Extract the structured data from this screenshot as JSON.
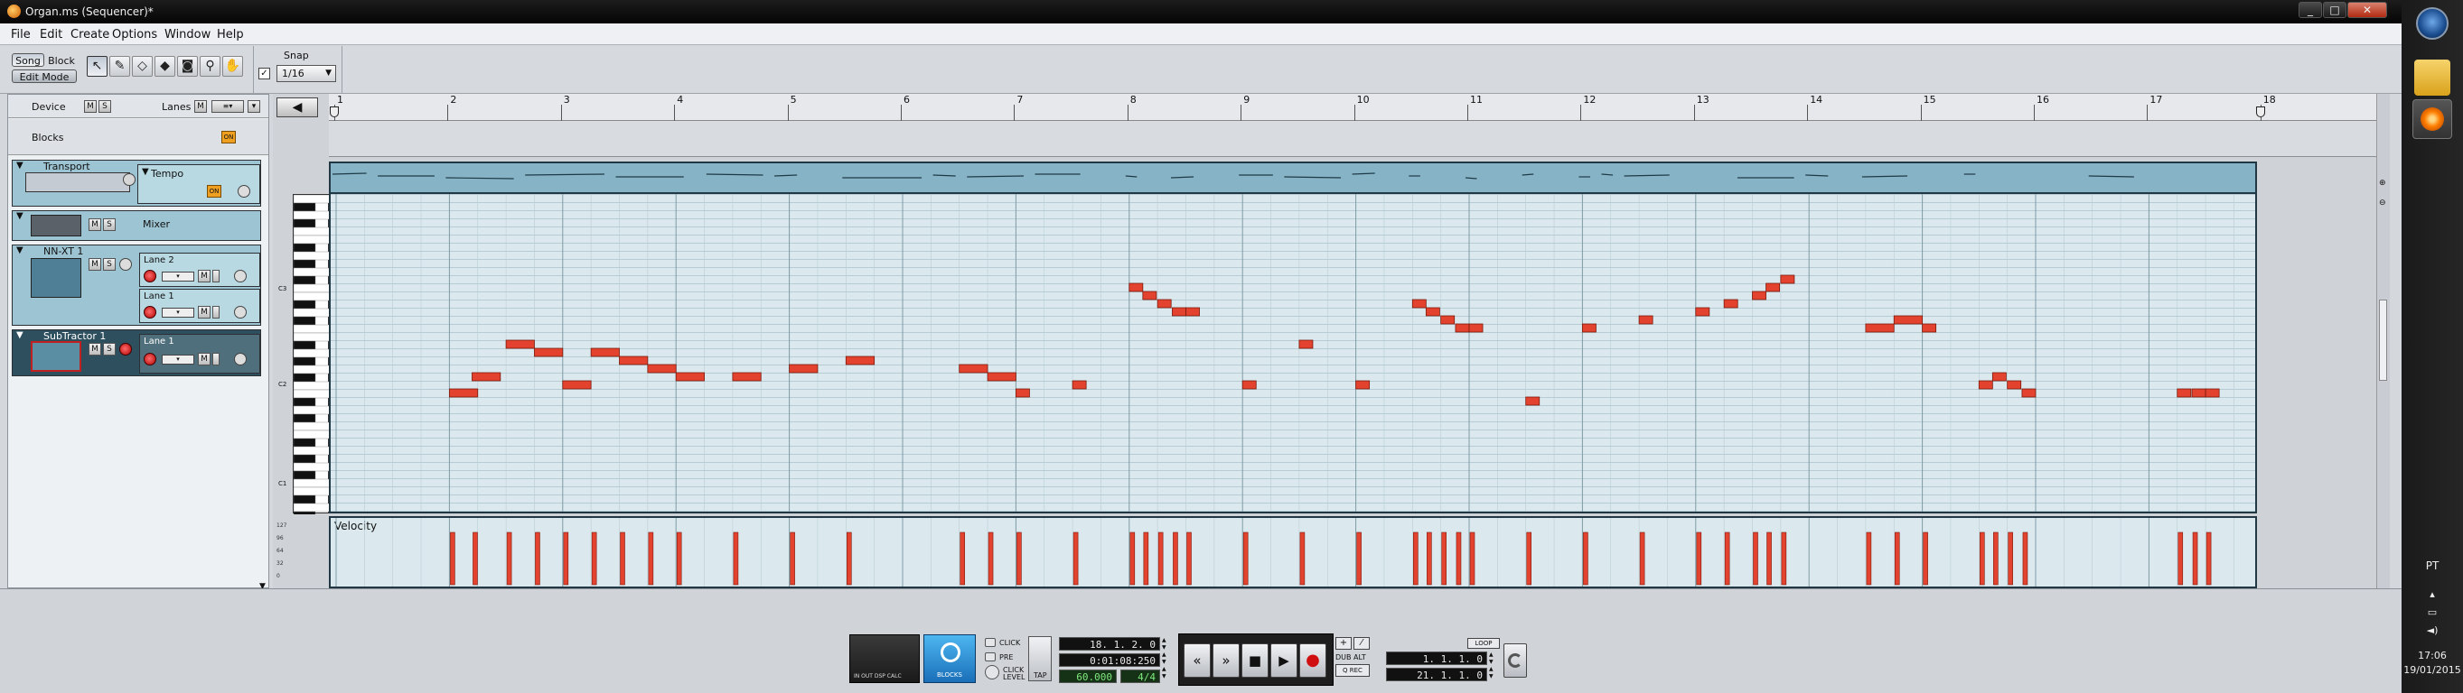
{
  "window": {
    "title": "Organ.ms (Sequencer)*",
    "controls": {
      "minimize": "_",
      "maximize": "□",
      "close": "✕"
    }
  },
  "menu": [
    "File",
    "Edit",
    "Create",
    "Options",
    "Window",
    "Help"
  ],
  "toolbar": {
    "mode_song": "Song",
    "mode_block": "Block",
    "mode_edit": "Edit Mode",
    "snap_label": "Snap",
    "snap_value": "1/16",
    "tools": [
      {
        "name": "select-arrow-icon",
        "glyph": "↖"
      },
      {
        "name": "pencil-icon",
        "glyph": "✎"
      },
      {
        "name": "eraser-icon",
        "glyph": "◇"
      },
      {
        "name": "razor-icon",
        "glyph": "◆"
      },
      {
        "name": "mute-tool-icon",
        "glyph": "◙"
      },
      {
        "name": "magnify-icon",
        "glyph": "⚲"
      },
      {
        "name": "hand-icon",
        "glyph": "✋"
      }
    ]
  },
  "device_panel": {
    "device_label": "Device",
    "lanes_label": "Lanes",
    "m": "M",
    "s": "S",
    "blocks_label": "Blocks",
    "on_label": "ON",
    "devices": [
      {
        "name": "Transport",
        "lane": "Tempo"
      },
      {
        "name": "Mixer"
      },
      {
        "name": "NN-XT 1",
        "lanes": [
          "Lane 2",
          "Lane 1"
        ]
      },
      {
        "name": "SubTractor 1",
        "lanes": [
          "Lane 1"
        ]
      }
    ]
  },
  "sequencer": {
    "bars": [
      "1",
      "2",
      "3",
      "4",
      "5",
      "6",
      "7",
      "8",
      "9",
      "10",
      "11",
      "12",
      "13",
      "14",
      "15",
      "16",
      "17",
      "18"
    ],
    "velocity_label": "Velocity",
    "vel_scale": [
      "127",
      "96",
      "64",
      "32",
      "0"
    ],
    "octave_labels": [
      "C3",
      "C2",
      "C1"
    ]
  },
  "notes": {
    "pitch_rows": 38,
    "items": [
      [
        1.0,
        0.25,
        28
      ],
      [
        1.2,
        0.25,
        26
      ],
      [
        1.5,
        0.25,
        22
      ],
      [
        1.75,
        0.25,
        23
      ],
      [
        2.0,
        0.25,
        27
      ],
      [
        2.25,
        0.25,
        23
      ],
      [
        2.5,
        0.25,
        24
      ],
      [
        2.75,
        0.25,
        25
      ],
      [
        3.0,
        0.25,
        26
      ],
      [
        3.5,
        0.25,
        26
      ],
      [
        4.0,
        0.25,
        25
      ],
      [
        4.5,
        0.25,
        24
      ],
      [
        5.5,
        0.25,
        25
      ],
      [
        5.75,
        0.25,
        26
      ],
      [
        6.0,
        0.12,
        28
      ],
      [
        6.5,
        0.12,
        27
      ],
      [
        7.0,
        0.12,
        15
      ],
      [
        7.12,
        0.12,
        16
      ],
      [
        7.25,
        0.12,
        17
      ],
      [
        7.38,
        0.12,
        18
      ],
      [
        7.5,
        0.12,
        18
      ],
      [
        8.0,
        0.12,
        27
      ],
      [
        8.5,
        0.12,
        22
      ],
      [
        9.0,
        0.12,
        27
      ],
      [
        9.5,
        0.12,
        17
      ],
      [
        9.62,
        0.12,
        18
      ],
      [
        9.75,
        0.12,
        19
      ],
      [
        9.88,
        0.12,
        20
      ],
      [
        10.0,
        0.12,
        20
      ],
      [
        10.5,
        0.12,
        29
      ],
      [
        11.0,
        0.12,
        20
      ],
      [
        11.5,
        0.12,
        19
      ],
      [
        12.0,
        0.12,
        18
      ],
      [
        12.25,
        0.12,
        17
      ],
      [
        12.5,
        0.12,
        16
      ],
      [
        12.62,
        0.12,
        15
      ],
      [
        12.75,
        0.12,
        14
      ],
      [
        13.5,
        0.25,
        20
      ],
      [
        13.75,
        0.25,
        19
      ],
      [
        14.0,
        0.12,
        20
      ],
      [
        14.5,
        0.12,
        27
      ],
      [
        14.62,
        0.12,
        26
      ],
      [
        14.75,
        0.12,
        27
      ],
      [
        14.88,
        0.12,
        28
      ],
      [
        16.25,
        0.12,
        28
      ],
      [
        16.38,
        0.12,
        28
      ],
      [
        16.5,
        0.12,
        28
      ]
    ]
  },
  "tempo_segments": [
    [
      1.0,
      1.3
    ],
    [
      1.4,
      1.9
    ],
    [
      2.0,
      2.6
    ],
    [
      2.7,
      3.4
    ],
    [
      3.5,
      4.1
    ],
    [
      4.3,
      4.8
    ],
    [
      4.9,
      5.1
    ],
    [
      5.5,
      6.2
    ],
    [
      6.3,
      6.5
    ],
    [
      6.6,
      7.1
    ],
    [
      7.2,
      7.6
    ],
    [
      8.0,
      8.1
    ],
    [
      8.4,
      8.6
    ],
    [
      9.0,
      9.3
    ],
    [
      9.4,
      9.9
    ],
    [
      10.0,
      10.2
    ],
    [
      10.5,
      10.6
    ],
    [
      11.0,
      11.1
    ],
    [
      11.5,
      11.6
    ],
    [
      12.0,
      12.1
    ],
    [
      12.2,
      12.3
    ],
    [
      12.4,
      12.8
    ],
    [
      13.4,
      13.9
    ],
    [
      14.0,
      14.2
    ],
    [
      14.5,
      14.9
    ],
    [
      15.4,
      15.5
    ],
    [
      16.5,
      16.9
    ]
  ],
  "transport": {
    "click": "CLICK",
    "pre": "PRE",
    "click_level": "CLICK LEVEL",
    "tap": "TAP",
    "blocks": "BLOCKS",
    "in_out": "IN  OUT  DSP  CALC",
    "position": "18. 1. 2.  0",
    "time": "0:01:08:250",
    "tempo": "60.000",
    "signature": "4/4",
    "dub": "DUB",
    "alt": "ALT",
    "qrec": "Q REC",
    "loop": "LOOP",
    "left_locator": "1. 1. 1.  0",
    "right_locator": "21. 1. 1.  0",
    "rewind": "«",
    "ffwd": "»",
    "stop": "■",
    "play": "▶",
    "record": "●"
  },
  "taskbar": {
    "lang": "PT",
    "time": "17:06",
    "date": "19/01/2015"
  },
  "colors": {
    "note": "#e3432e",
    "note_border": "#7a1a0d",
    "tempo_lane": "#86b3c5",
    "lane_bg": "#dbe9ee",
    "frame": "#213844"
  }
}
